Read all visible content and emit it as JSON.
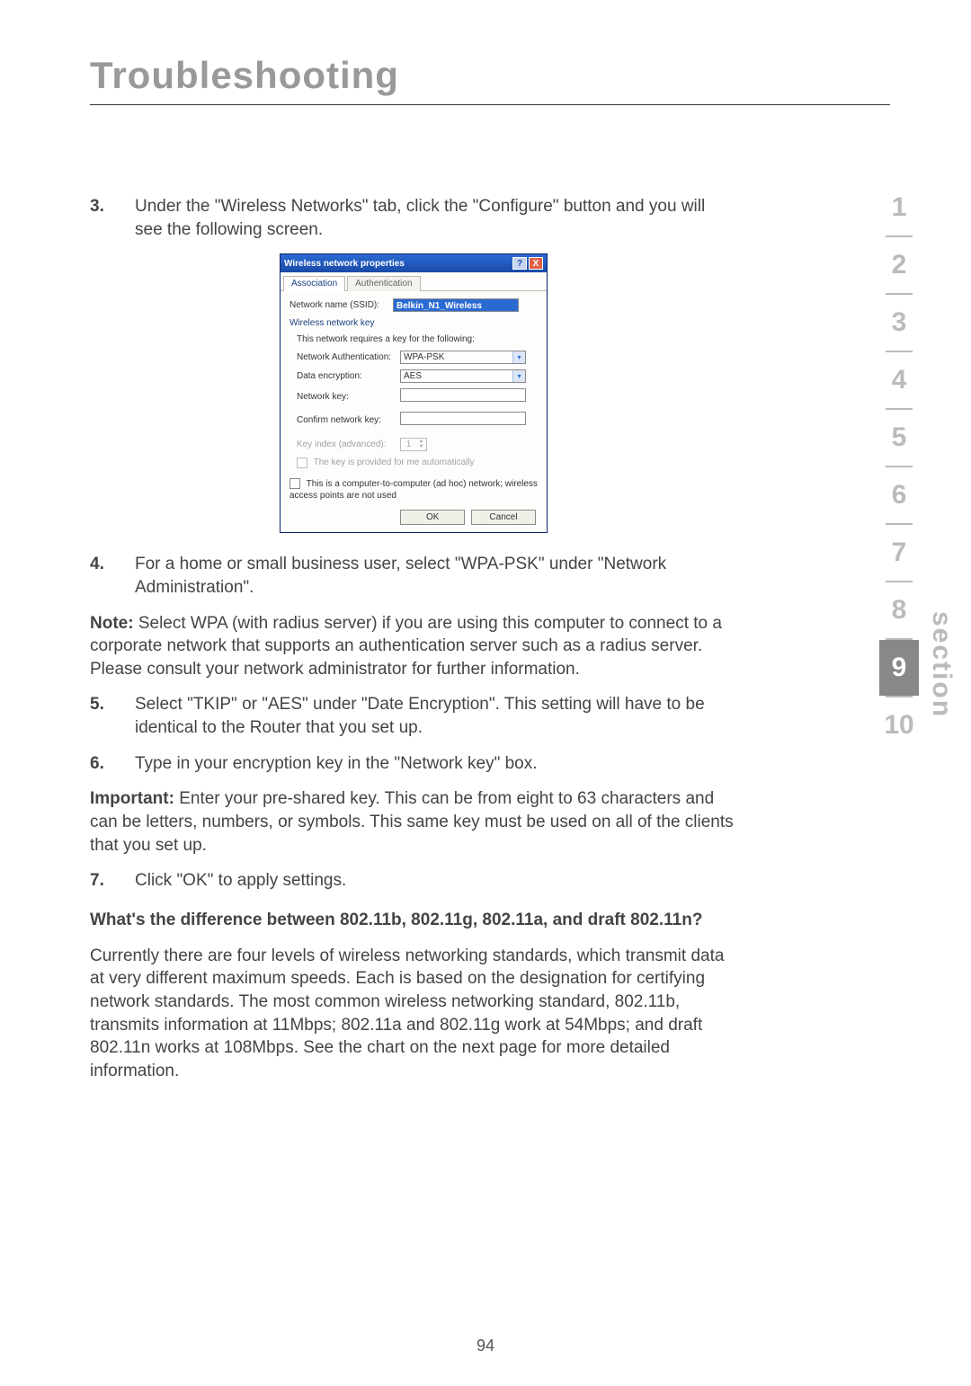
{
  "page": {
    "title": "Troubleshooting",
    "number": "94"
  },
  "side": {
    "label": "section",
    "items": [
      "1",
      "2",
      "3",
      "4",
      "5",
      "6",
      "7",
      "8",
      "9",
      "10"
    ],
    "active": "9"
  },
  "steps": {
    "s3": {
      "num": "3.",
      "text": "Under the \"Wireless Networks\" tab, click the \"Configure\" button and you will see the following screen."
    },
    "s4": {
      "num": "4.",
      "text": "For a home or small business user, select \"WPA-PSK\" under \"Network Administration\"."
    },
    "s5": {
      "num": "5.",
      "text": "Select \"TKIP\" or \"AES\" under \"Date Encryption\". This setting will have to be identical to the Router that you set up."
    },
    "s6": {
      "num": "6.",
      "text": "Type in your encryption key in the \"Network key\" box."
    },
    "s7": {
      "num": "7.",
      "text": "Click \"OK\" to apply settings."
    }
  },
  "note": {
    "label": "Note:",
    "text": " Select WPA (with radius server) if you are using this computer to connect to a corporate network that supports an authentication server such as a radius server. Please consult your network administrator for further information."
  },
  "important": {
    "label": "Important:",
    "text": " Enter your pre-shared key. This can be from eight to 63 characters and can be letters, numbers, or symbols. This same key must be used on all of the clients that you set up."
  },
  "subhead": "What's the difference between 802.11b, 802.11g, 802.11a, and draft 802.11n?",
  "para": "Currently there are four levels of wireless networking standards, which transmit data at very different maximum speeds. Each is based on the designation for certifying network standards. The most common wireless networking standard, 802.11b, transmits information at 11Mbps; 802.11a and 802.11g work at 54Mbps; and draft 802.11n works at 108Mbps. See the chart on the next page for more detailed information.",
  "dialog": {
    "title": "Wireless network properties",
    "tabs": {
      "association": "Association",
      "authentication": "Authentication"
    },
    "ssid_label": "Network name (SSID):",
    "ssid_value": "Belkin_N1_Wireless",
    "wnk_header": "Wireless network key",
    "wnk_sub": "This network requires a key for the following:",
    "auth_label": "Network Authentication:",
    "auth_value": "WPA-PSK",
    "enc_label": "Data encryption:",
    "enc_value": "AES",
    "key_label": "Network key:",
    "confirm_label": "Confirm network key:",
    "keyindex_label": "Key index (advanced):",
    "keyindex_value": "1",
    "auto_label": "The key is provided for me automatically",
    "adhoc_label": "This is a computer-to-computer (ad hoc) network; wireless access points are not used",
    "ok": "OK",
    "cancel": "Cancel",
    "help": "?",
    "close": "X"
  }
}
